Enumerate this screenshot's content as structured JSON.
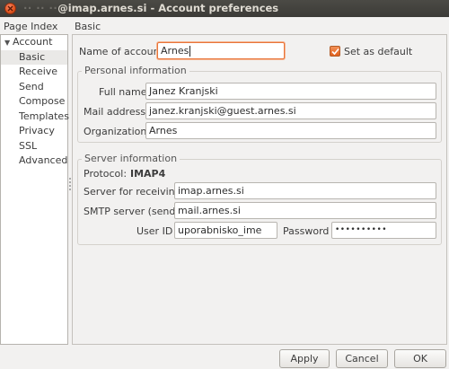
{
  "window": {
    "title_obscured": "·· ·· ··",
    "title": "@imap.arnes.si - Account preferences"
  },
  "left": {
    "header": "Page Index",
    "tree": [
      {
        "label": "Account",
        "parent": true
      },
      {
        "label": "Basic",
        "selected": true
      },
      {
        "label": "Receive"
      },
      {
        "label": "Send"
      },
      {
        "label": "Compose"
      },
      {
        "label": "Templates"
      },
      {
        "label": "Privacy"
      },
      {
        "label": "SSL"
      },
      {
        "label": "Advanced"
      }
    ]
  },
  "right": {
    "header": "Basic",
    "account_name_label": "Name of account",
    "account_name_value": "Arnes",
    "set_default_label": "Set as default",
    "set_default_checked": true,
    "personal": {
      "title": "Personal information",
      "full_name_label": "Full name",
      "full_name_value": "Janez Kranjski",
      "mail_label": "Mail address",
      "mail_value": "janez.kranjski@guest.arnes.si",
      "org_label": "Organization",
      "org_value": "Arnes"
    },
    "server": {
      "title": "Server information",
      "protocol_label": "Protocol:",
      "protocol_value": "IMAP4",
      "recv_label": "Server for receiving",
      "recv_value": "imap.arnes.si",
      "smtp_label": "SMTP server (send)",
      "smtp_value": "mail.arnes.si",
      "userid_label": "User ID",
      "userid_value": "uporabnisko_ime",
      "password_label": "Password",
      "password_value": "••••••••••"
    }
  },
  "buttons": {
    "apply": "Apply",
    "cancel": "Cancel",
    "ok": "OK"
  },
  "colors": {
    "accent": "#e8743a",
    "titlebar": "#3c3b37"
  }
}
